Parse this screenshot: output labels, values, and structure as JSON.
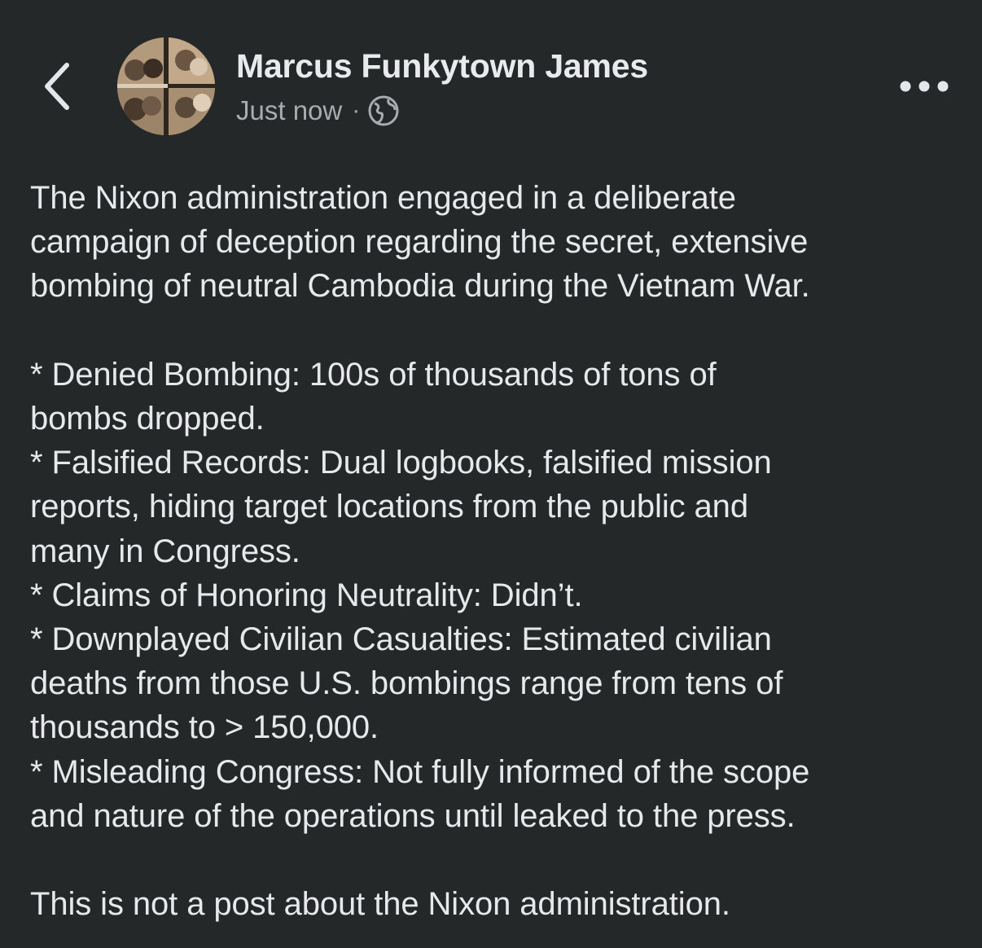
{
  "header": {
    "back_icon": "chevron-left-icon",
    "author_name": "Marcus Funkytown James",
    "timestamp": "Just now",
    "separator": "·",
    "privacy_icon": "globe-icon",
    "more_icon": "more-horizontal-icon"
  },
  "post": {
    "intro": [
      "The Nixon administration engaged in a deliberate",
      "campaign of deception regarding the secret, extensive",
      "bombing of neutral Cambodia during the Vietnam War."
    ],
    "bullets": [
      "* Denied Bombing: 100s of thousands of tons of",
      "bombs dropped.",
      "* Falsified Records: Dual logbooks, falsified mission",
      "reports, hiding target locations from the public and",
      "many in Congress.",
      "* Claims of Honoring Neutrality: Didn’t.",
      "* Downplayed Civilian Casualties: Estimated civilian",
      "deaths from those U.S. bombings range from tens of",
      "thousands to > 150,000.",
      "* Misleading Congress: Not fully informed of the scope",
      "and nature of the operations until leaked to the press."
    ],
    "closing": "This is not a post about the Nixon administration."
  },
  "colors": {
    "background": "#252829",
    "text_primary": "#e6e8eb",
    "text_secondary": "#a8abaf"
  }
}
